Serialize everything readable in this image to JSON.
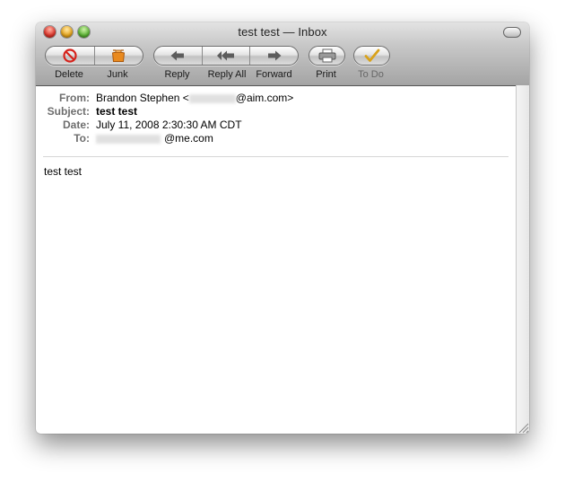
{
  "window": {
    "title": "test test — Inbox"
  },
  "toolbar": {
    "delete": "Delete",
    "junk": "Junk",
    "reply": "Reply",
    "reply_all": "Reply All",
    "forward": "Forward",
    "print": "Print",
    "todo": "To Do"
  },
  "message": {
    "from_label": "From:",
    "from_prefix": "Brandon Stephen <",
    "from_suffix": "@aim.com>",
    "subject_label": "Subject:",
    "subject": "test test",
    "date_label": "Date:",
    "date": "July 11, 2008 2:30:30 AM CDT",
    "to_label": "To:",
    "to_suffix": "@me.com",
    "body": "test test"
  },
  "colors": {
    "header_label": "#6d6d6d",
    "close": "#e0352b",
    "minimize": "#e7a51c",
    "zoom": "#5bb534",
    "junk_icon": "#e98a1f",
    "todo_check": "#d9a21a"
  },
  "icons": [
    "close-icon",
    "minimize-icon",
    "zoom-icon",
    "toolbar-toggle-icon",
    "delete-icon",
    "junk-icon",
    "reply-icon",
    "reply-all-icon",
    "forward-icon",
    "print-icon",
    "todo-check-icon",
    "resize-grip-icon"
  ]
}
